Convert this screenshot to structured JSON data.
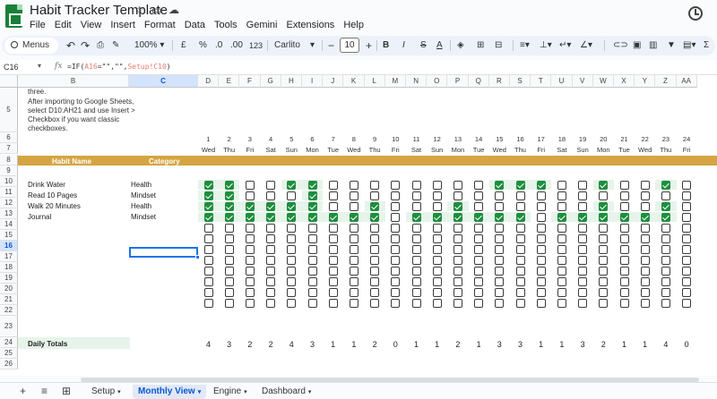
{
  "app": {
    "title": "Habit Tracker Template",
    "menus": [
      "File",
      "Edit",
      "View",
      "Insert",
      "Format",
      "Data",
      "Tools",
      "Gemini",
      "Extensions",
      "Help"
    ]
  },
  "toolbar": {
    "search": "Menus",
    "zoom": "100%",
    "currency": "£",
    "percent": "%",
    "decimal_decrease": ".0",
    "decimal_increase": ".00",
    "number_format": "123",
    "font": "Carlito",
    "minus": "−",
    "font_size": "10",
    "plus": "+",
    "bold": "B",
    "italic": "I",
    "strike": "S",
    "text_color": "A"
  },
  "formula_bar": {
    "cell": "C16",
    "fx": "fx",
    "formula_prefix": "=IF(",
    "formula_ref": "A16",
    "formula_mid": "=\"\",\"\",",
    "formula_ref2": "Setup!C10",
    "formula_suffix": ")"
  },
  "columns": [
    "B",
    "C",
    "D",
    "E",
    "F",
    "G",
    "H",
    "I",
    "J",
    "K",
    "L",
    "M",
    "N",
    "O",
    "P",
    "Q",
    "R",
    "S",
    "T",
    "U",
    "V",
    "W",
    "X",
    "Y",
    "Z",
    "AA"
  ],
  "rows": [
    "5",
    "6",
    "7",
    "8",
    "9",
    "10",
    "11",
    "12",
    "13",
    "14",
    "15",
    "16",
    "17",
    "18",
    "19",
    "20",
    "21",
    "22",
    "23",
    "24",
    "25",
    "26"
  ],
  "notes": {
    "top": "three.",
    "body": "After importing to Google Sheets, select D10:AH21 and use Insert > Checkbox if you want classic checkboxes."
  },
  "days": [
    "1",
    "2",
    "3",
    "4",
    "5",
    "6",
    "7",
    "8",
    "9",
    "10",
    "11",
    "12",
    "13",
    "14",
    "15",
    "16",
    "17",
    "18",
    "19",
    "20",
    "21",
    "22",
    "23",
    "24"
  ],
  "weekdays": [
    "Wed",
    "Thu",
    "Fri",
    "Sat",
    "Sun",
    "Mon",
    "Tue",
    "Wed",
    "Thu",
    "Fri",
    "Sat",
    "Sun",
    "Mon",
    "Tue",
    "Wed",
    "Thu",
    "Fri",
    "Sat",
    "Sun",
    "Mon",
    "Tue",
    "Wed",
    "Thu",
    "Fri"
  ],
  "header_band": {
    "habit": "Habit Name",
    "category": "Category"
  },
  "habits": [
    {
      "name": "Drink Water",
      "category": "Health",
      "checks": [
        1,
        1,
        0,
        0,
        1,
        1,
        0,
        0,
        0,
        0,
        0,
        0,
        0,
        0,
        1,
        1,
        1,
        0,
        0,
        1,
        0,
        0,
        1,
        0
      ]
    },
    {
      "name": "Read 10 Pages",
      "category": "Mindset",
      "checks": [
        1,
        1,
        0,
        0,
        0,
        1,
        0,
        0,
        0,
        0,
        0,
        0,
        0,
        0,
        0,
        0,
        0,
        0,
        0,
        0,
        0,
        0,
        0,
        0
      ]
    },
    {
      "name": "Walk 20 Minutes",
      "category": "Health",
      "checks": [
        1,
        1,
        1,
        1,
        1,
        1,
        0,
        0,
        1,
        0,
        0,
        0,
        1,
        0,
        0,
        0,
        0,
        0,
        0,
        1,
        0,
        0,
        1,
        0
      ]
    },
    {
      "name": "Journal",
      "category": "Mindset",
      "checks": [
        1,
        1,
        1,
        1,
        1,
        1,
        1,
        1,
        1,
        0,
        1,
        1,
        1,
        1,
        1,
        1,
        0,
        1,
        1,
        1,
        1,
        1,
        1,
        0
      ]
    }
  ],
  "empty_rows": 8,
  "totals": {
    "label": "Daily Totals",
    "values": [
      "4",
      "3",
      "2",
      "2",
      "4",
      "3",
      "1",
      "1",
      "2",
      "0",
      "1",
      "1",
      "2",
      "1",
      "3",
      "3",
      "1",
      "1",
      "3",
      "2",
      "1",
      "1",
      "4",
      "0"
    ]
  },
  "sheets": [
    {
      "name": "Setup",
      "active": false
    },
    {
      "name": "Monthly View",
      "active": true
    },
    {
      "name": "Engine",
      "active": false
    },
    {
      "name": "Dashboard",
      "active": false
    }
  ],
  "colors": {
    "accent": "#d4a542",
    "check": "#1e8e3e",
    "highlight": "#e6f4ea",
    "selection": "#1a73e8"
  }
}
